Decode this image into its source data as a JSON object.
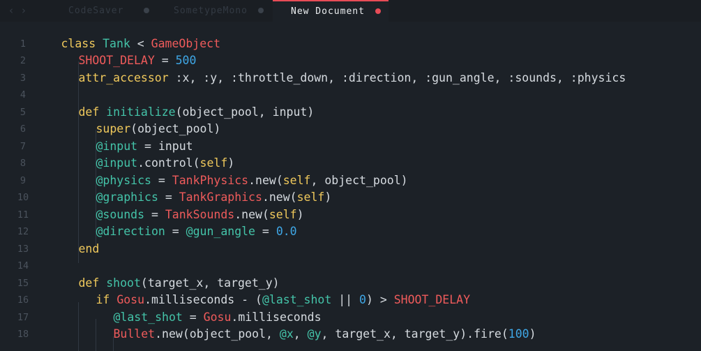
{
  "tabs": [
    {
      "label": "CodeSaver",
      "active": false
    },
    {
      "label": "SometypeMono",
      "active": false
    },
    {
      "label": "New Document",
      "active": true
    }
  ],
  "nav": {
    "back": "‹",
    "forward": "›"
  },
  "colors": {
    "background": "#1c2127",
    "tabbar": "#1a1e23",
    "accent": "#e74c57",
    "keyword": "#f0c95c",
    "class": "#44c4a9",
    "constant": "#ef5b5b",
    "number": "#3fa7e6",
    "text": "#d6dbe0",
    "line_number": "#4b535d"
  },
  "lines": [
    {
      "n": "1",
      "indent": 0,
      "tokens": [
        [
          "kw",
          "class "
        ],
        [
          "cls",
          "Tank"
        ],
        [
          "txt",
          " < "
        ],
        [
          "const",
          "GameObject"
        ]
      ]
    },
    {
      "n": "2",
      "indent": 1,
      "tokens": [
        [
          "const",
          "SHOOT_DELAY"
        ],
        [
          "txt",
          " = "
        ],
        [
          "num",
          "500"
        ]
      ]
    },
    {
      "n": "3",
      "indent": 1,
      "tokens": [
        [
          "kw",
          "attr_accessor"
        ],
        [
          "txt",
          " :x, :y, :throttle_down, :direction, :gun_angle, :sounds, :physics"
        ]
      ]
    },
    {
      "n": "4",
      "indent": 0,
      "tokens": []
    },
    {
      "n": "5",
      "indent": 1,
      "tokens": [
        [
          "kw",
          "def "
        ],
        [
          "fn",
          "initialize"
        ],
        [
          "txt",
          "(object_pool, input)"
        ]
      ]
    },
    {
      "n": "6",
      "indent": 2,
      "tokens": [
        [
          "kw",
          "super"
        ],
        [
          "txt",
          "(object_pool)"
        ]
      ]
    },
    {
      "n": "7",
      "indent": 2,
      "tokens": [
        [
          "ivar",
          "@input"
        ],
        [
          "txt",
          " = input"
        ]
      ]
    },
    {
      "n": "8",
      "indent": 2,
      "tokens": [
        [
          "ivar",
          "@input"
        ],
        [
          "txt",
          ".control("
        ],
        [
          "kw",
          "self"
        ],
        [
          "txt",
          ")"
        ]
      ]
    },
    {
      "n": "9",
      "indent": 2,
      "tokens": [
        [
          "ivar",
          "@physics"
        ],
        [
          "txt",
          " = "
        ],
        [
          "const",
          "TankPhysics"
        ],
        [
          "txt",
          ".new("
        ],
        [
          "kw",
          "self"
        ],
        [
          "txt",
          ", object_pool)"
        ]
      ]
    },
    {
      "n": "10",
      "indent": 2,
      "tokens": [
        [
          "ivar",
          "@graphics"
        ],
        [
          "txt",
          " = "
        ],
        [
          "const",
          "TankGraphics"
        ],
        [
          "txt",
          ".new("
        ],
        [
          "kw",
          "self"
        ],
        [
          "txt",
          ")"
        ]
      ]
    },
    {
      "n": "11",
      "indent": 2,
      "tokens": [
        [
          "ivar",
          "@sounds"
        ],
        [
          "txt",
          " = "
        ],
        [
          "const",
          "TankSounds"
        ],
        [
          "txt",
          ".new("
        ],
        [
          "kw",
          "self"
        ],
        [
          "txt",
          ")"
        ]
      ]
    },
    {
      "n": "12",
      "indent": 2,
      "tokens": [
        [
          "ivar",
          "@direction"
        ],
        [
          "txt",
          " = "
        ],
        [
          "ivar",
          "@gun_angle"
        ],
        [
          "txt",
          " = "
        ],
        [
          "num",
          "0.0"
        ]
      ]
    },
    {
      "n": "13",
      "indent": 1,
      "tokens": [
        [
          "kw",
          "end"
        ]
      ]
    },
    {
      "n": "14",
      "indent": 0,
      "tokens": []
    },
    {
      "n": "15",
      "indent": 1,
      "tokens": [
        [
          "kw",
          "def "
        ],
        [
          "fn",
          "shoot"
        ],
        [
          "txt",
          "(target_x, target_y)"
        ]
      ]
    },
    {
      "n": "16",
      "indent": 2,
      "tokens": [
        [
          "kw",
          "if "
        ],
        [
          "const",
          "Gosu"
        ],
        [
          "txt",
          ".milliseconds - ("
        ],
        [
          "ivar",
          "@last_shot"
        ],
        [
          "txt",
          " || "
        ],
        [
          "num",
          "0"
        ],
        [
          "txt",
          ") > "
        ],
        [
          "const",
          "SHOOT_DELAY"
        ]
      ]
    },
    {
      "n": "17",
      "indent": 3,
      "tokens": [
        [
          "ivar",
          "@last_shot"
        ],
        [
          "txt",
          " = "
        ],
        [
          "const",
          "Gosu"
        ],
        [
          "txt",
          ".milliseconds"
        ]
      ]
    },
    {
      "n": "18",
      "indent": 3,
      "tokens": [
        [
          "const",
          "Bullet"
        ],
        [
          "txt",
          ".new(object_pool, "
        ],
        [
          "ivar",
          "@x"
        ],
        [
          "txt",
          ", "
        ],
        [
          "ivar",
          "@y"
        ],
        [
          "txt",
          ", target_x, target_y).fire("
        ],
        [
          "num",
          "100"
        ],
        [
          "txt",
          ")"
        ]
      ]
    }
  ]
}
